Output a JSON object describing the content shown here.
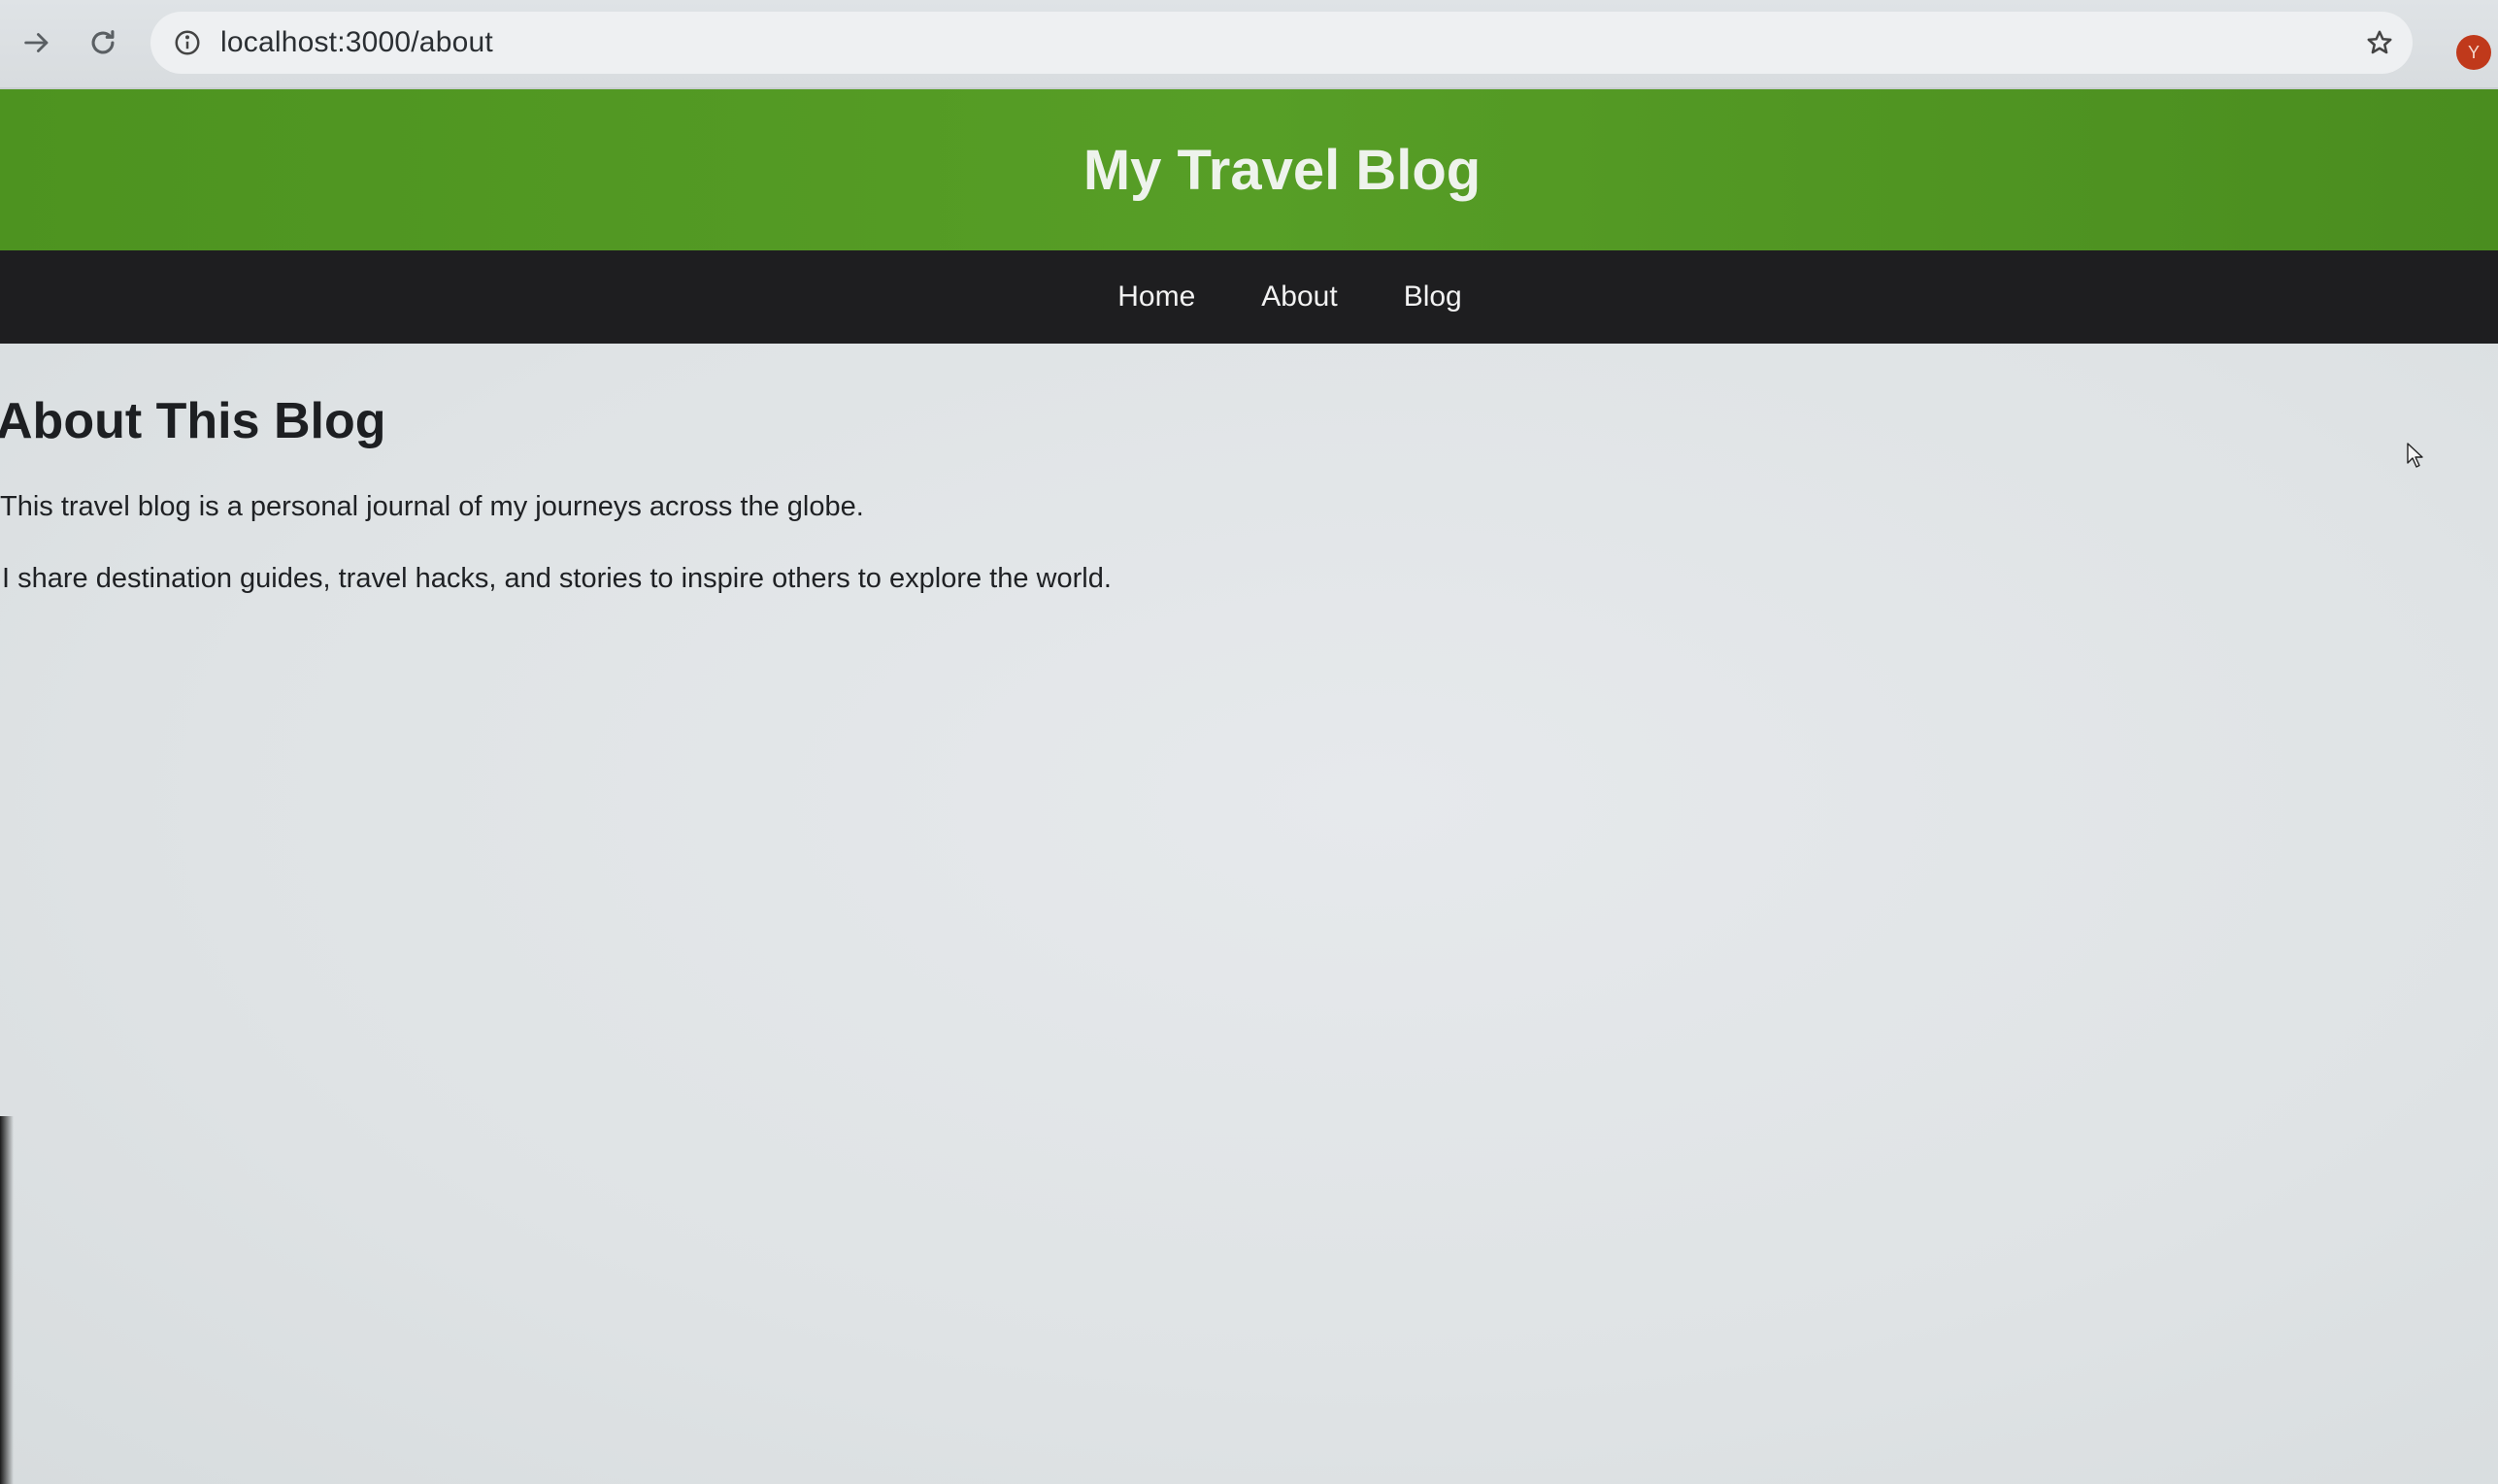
{
  "browser": {
    "url": "localhost:3000/about",
    "avatar_letter": "Y",
    "avatar_color": "#c0391b"
  },
  "site": {
    "title": "My Travel Blog",
    "header_color": "#579e26",
    "nav_color": "#1e1e20",
    "nav": [
      "Home",
      "About",
      "Blog"
    ]
  },
  "page": {
    "heading": "About This Blog",
    "paragraphs": [
      "This travel blog is a personal journal of my journeys across the globe.",
      "I share destination guides, travel hacks, and stories to inspire others to explore the world."
    ]
  },
  "icons": {
    "forward": "forward-arrow-icon",
    "reload": "reload-icon",
    "info": "info-icon",
    "bookmark": "star-icon",
    "cursor": "mouse-pointer-icon"
  }
}
